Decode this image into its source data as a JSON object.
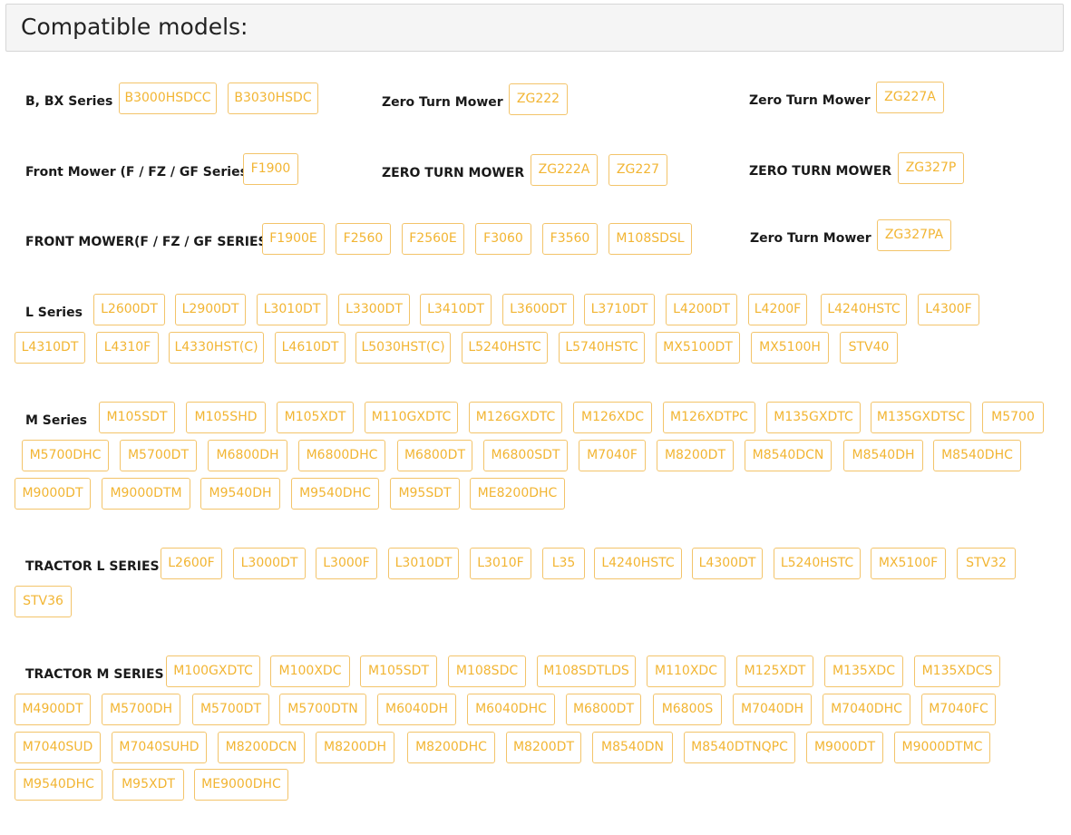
{
  "header": {
    "title": "Compatible models:"
  },
  "groups": [
    {
      "label": "B, BX Series",
      "models": [
        "B3000HSDCC",
        "B3030HSDC"
      ]
    },
    {
      "label": "Zero Turn Mower",
      "models": [
        "ZG222"
      ]
    },
    {
      "label": "Zero Turn Mower",
      "models": [
        "ZG227A"
      ]
    },
    {
      "label": "Front Mower (F / FZ / GF Series)",
      "models": [
        "F1900"
      ]
    },
    {
      "label": "ZERO TURN MOWER",
      "models": [
        "ZG222A",
        "ZG227"
      ]
    },
    {
      "label": "ZERO TURN MOWER",
      "models": [
        "ZG327P"
      ]
    },
    {
      "label": "FRONT MOWER(F / FZ / GF SERIES)",
      "models": [
        "F1900E",
        "F2560",
        "F2560E",
        "F3060",
        "F3560",
        "M108SDSL"
      ]
    },
    {
      "label": "Zero Turn Mower",
      "models": [
        "ZG327PA"
      ]
    },
    {
      "label": "L Series",
      "models": [
        "L2600DT",
        "L2900DT",
        "L3010DT",
        "L3300DT",
        "L3410DT",
        "L3600DT",
        "L3710DT",
        "L4200DT",
        "L4200F",
        "L4240HSTC",
        "L4300F",
        "L4310DT",
        "L4310F",
        "L4330HST(C)",
        "L4610DT",
        "L5030HST(C)",
        "L5240HSTC",
        "L5740HSTC",
        "MX5100DT",
        "MX5100H",
        "STV40"
      ]
    },
    {
      "label": "M Series",
      "models": [
        "M105SDT",
        "M105SHD",
        "M105XDT",
        "M110GXDTC",
        "M126GXDTC",
        "M126XDC",
        "M126XDTPC",
        "M135GXDTC",
        "M135GXDTSC",
        "M5700",
        "M5700DHC",
        "M5700DT",
        "M6800DH",
        "M6800DHC",
        "M6800DT",
        "M6800SDT",
        "M7040F",
        "M8200DT",
        "M8540DCN",
        "M8540DH",
        "M8540DHC",
        "M9000DT",
        "M9000DTM",
        "M9540DH",
        "M9540DHC",
        "M95SDT",
        "ME8200DHC"
      ]
    },
    {
      "label": "TRACTOR L SERIES",
      "models": [
        "L2600F",
        "L3000DT",
        "L3000F",
        "L3010DT",
        "L3010F",
        "L35",
        "L4240HSTC",
        "L4300DT",
        "L5240HSTC",
        "MX5100F",
        "STV32",
        "STV36"
      ]
    },
    {
      "label": "TRACTOR M SERIES",
      "models": [
        "M100GXDTC",
        "M100XDC",
        "M105SDT",
        "M108SDC",
        "M108SDTLDS",
        "M110XDC",
        "M125XDT",
        "M135XDC",
        "M135XDCS",
        "M4900DT",
        "M5700DH",
        "M5700DT",
        "M5700DTN",
        "M6040DH",
        "M6040DHC",
        "M6800DT",
        "M6800S",
        "M7040DH",
        "M7040DHC",
        "M7040FC",
        "M7040SUD",
        "M7040SUHD",
        "M8200DCN",
        "M8200DH",
        "M8200DHC",
        "M8200DT",
        "M8540DN",
        "M8540DTNQPC",
        "M9000DT",
        "M9000DTMC",
        "M9540DHC",
        "M95XDT",
        "ME9000DHC"
      ]
    }
  ]
}
